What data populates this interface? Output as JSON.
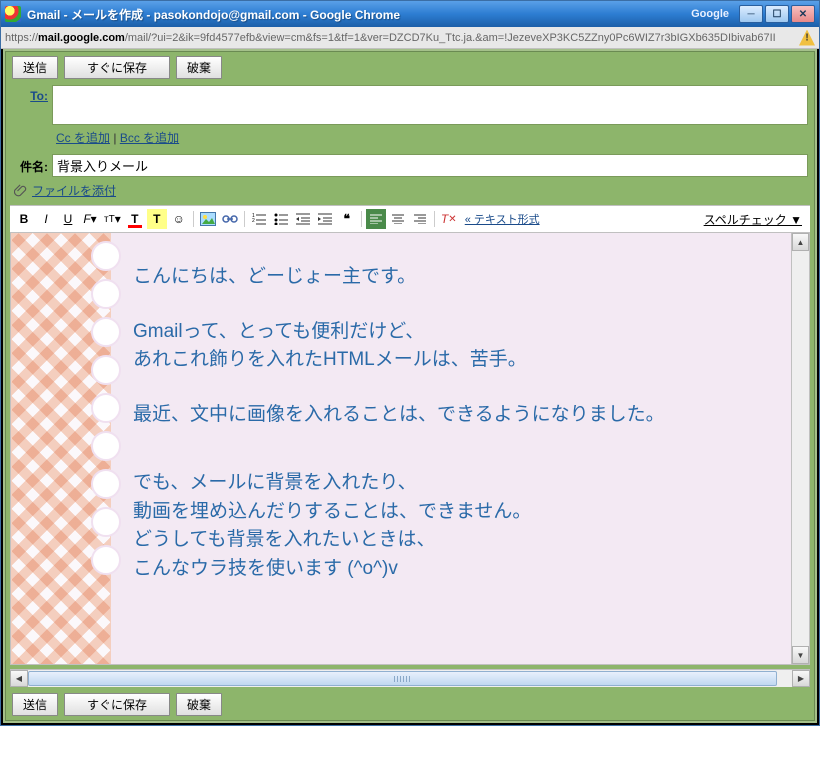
{
  "window": {
    "title": "Gmail - メールを作成 - pasokondojo@gmail.com - Google Chrome",
    "search": "Google"
  },
  "url": {
    "prefix": "https://",
    "host": "mail.google.com",
    "path": "/mail/?ui=2&ik=9fd4577efb&view=cm&fs=1&tf=1&ver=DZCD7Ku_Ttc.ja.&am=!JezeveXP3KC5ZZny0Pc6WIZ7r3bIGXb635DIbivab67II"
  },
  "buttons": {
    "send": "送信",
    "saveNow": "すぐに保存",
    "discard": "破棄"
  },
  "labels": {
    "to": "To:",
    "subject": "件名:",
    "addCc": "Cc を追加",
    "addBcc": "Bcc を追加",
    "sep": " | ",
    "attach": "ファイルを添付",
    "plainText": "« テキスト形式",
    "spellcheck": "スペルチェック ▼"
  },
  "fields": {
    "to": "",
    "subject": "背景入りメール"
  },
  "body": {
    "p1": "こんにちは、どーじょー主です。",
    "p2a": "Gmailって、とっても便利だけど、",
    "p2b": "あれこれ飾りを入れたHTMLメールは、苦手。",
    "p3": "最近、文中に画像を入れることは、できるようになりました。",
    "p4a": "でも、メールに背景を入れたり、",
    "p4b": "動画を埋め込んだりすることは、できません。",
    "p4c": "どうしても背景を入れたいときは、",
    "p4d": "こんなウラ技を使います   (^o^)v"
  },
  "toolbar": {
    "bold": "B",
    "italic": "I",
    "underline": "U"
  }
}
